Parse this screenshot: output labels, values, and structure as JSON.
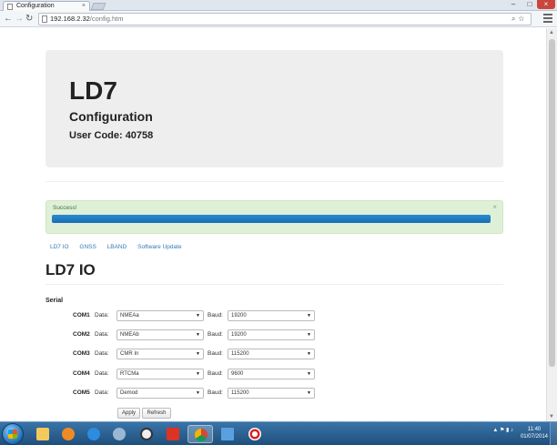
{
  "browser": {
    "tab_title": "Configuration",
    "tab_close": "×",
    "url_host": "192.168.2.32",
    "url_path": "/config.htm"
  },
  "header": {
    "device": "LD7",
    "subtitle": "Configuration",
    "user_code_label": "User Code:",
    "user_code": "40758"
  },
  "alert": {
    "message": "Success!",
    "close": "×",
    "progress_percent": 100
  },
  "nav": {
    "links": [
      "LD7 IO",
      "GNSS",
      "LBAND",
      "Software Update"
    ]
  },
  "section": {
    "title": "LD7 IO",
    "group_label": "Serial"
  },
  "labels": {
    "data": "Data:",
    "baud": "Baud:"
  },
  "com_ports": [
    {
      "name": "COM1",
      "data": "NMEAa",
      "baud": "19200"
    },
    {
      "name": "COM2",
      "data": "NMEAb",
      "baud": "19200"
    },
    {
      "name": "COM3",
      "data": "CMR In",
      "baud": "115200"
    },
    {
      "name": "COM4",
      "data": "RTCMa",
      "baud": "9600"
    },
    {
      "name": "COM5",
      "data": "Demod",
      "baud": "115200"
    }
  ],
  "buttons": {
    "apply": "Apply",
    "refresh": "Refresh"
  },
  "taskbar": {
    "time": "11:40",
    "date": "01/07/2014"
  },
  "icons": {
    "start": "windows-start-icon",
    "apps": [
      "folder-icon",
      "media-player-icon",
      "internet-explorer-icon",
      "tools-icon",
      "compass-icon",
      "red-app-icon",
      "chrome-icon",
      "screen-icon",
      "target-icon"
    ]
  },
  "colors": {
    "success_bg": "#dff0d8",
    "progress": "#1a6db3",
    "link": "#337ab7",
    "jumbotron_bg": "#eeeeee"
  }
}
